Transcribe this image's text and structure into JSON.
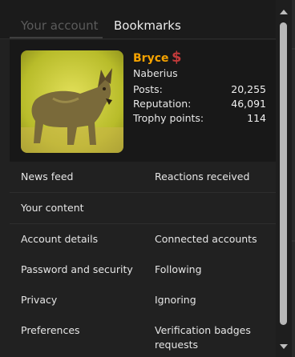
{
  "tabs": {
    "your_account": "Your account",
    "bookmarks": "Bookmarks"
  },
  "profile": {
    "username": "Bryce",
    "badge_icon": "dollar-badge-icon",
    "badge_glyph": "$",
    "title": "Naberius",
    "stats": [
      {
        "label": "Posts:",
        "value": "20,255"
      },
      {
        "label": "Reputation:",
        "value": "46,091"
      },
      {
        "label": "Trophy points:",
        "value": "114"
      }
    ]
  },
  "menu": {
    "news_feed": "News feed",
    "reactions_received": "Reactions received",
    "your_content": "Your content",
    "account_details": "Account details",
    "connected_accounts": "Connected accounts",
    "password_security": "Password and security",
    "following": "Following",
    "privacy": "Privacy",
    "ignoring": "Ignoring",
    "preferences": "Preferences",
    "verification_line1": "Verification badges",
    "verification_line2": "requests"
  },
  "colors": {
    "username": "#f6a300",
    "badge": "#c23a3a",
    "panel": "#212121",
    "card": "#181818"
  }
}
